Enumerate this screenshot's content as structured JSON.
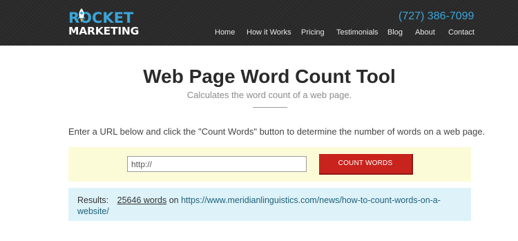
{
  "header": {
    "logo_top": "ROCKET",
    "logo_bottom": "MARKETING",
    "phone": "(727) 386-7099",
    "nav": [
      {
        "label": "Home"
      },
      {
        "label": "How it Works"
      },
      {
        "label": "Pricing"
      },
      {
        "label": "Testimonials"
      },
      {
        "label": "Blog"
      },
      {
        "label": "About"
      },
      {
        "label": "Contact"
      }
    ]
  },
  "main": {
    "title": "Web Page Word Count Tool",
    "subtitle": "Calculates the word count of a web page.",
    "instructions": "Enter a URL below and click the \"Count Words\" button to determine the number of words on a web page."
  },
  "form": {
    "url_value": "http://",
    "button_label": "COUNT WORDS"
  },
  "results": {
    "label": "Results:",
    "word_count": "25646 words",
    "on_text": "on",
    "url": "https://www.meridianlinguistics.com/news/how-to-count-words-on-a-website/"
  },
  "colors": {
    "header_bg": "#2b2b2b",
    "accent_blue": "#3aa6d8",
    "button_red": "#c9231e",
    "form_bg": "#fcfbd7",
    "results_bg": "#ddf3f9"
  }
}
